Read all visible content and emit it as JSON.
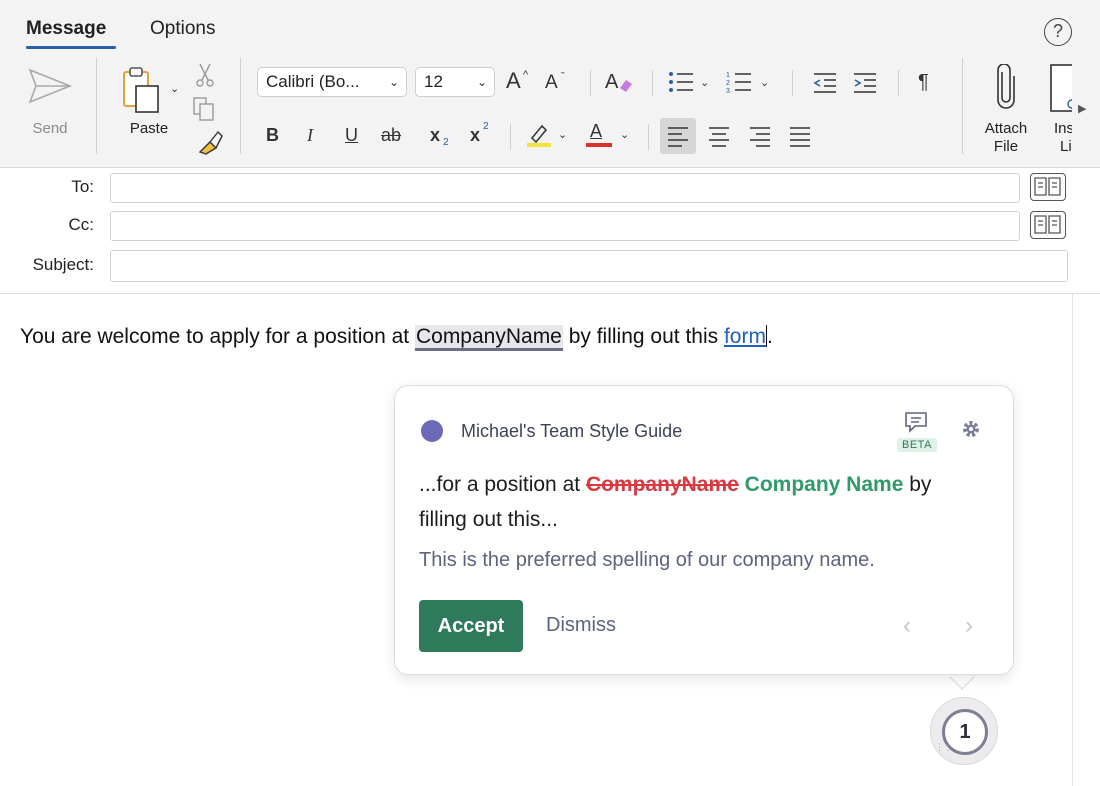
{
  "tabs": [
    {
      "label": "Message",
      "active": true
    },
    {
      "label": "Options",
      "active": false
    }
  ],
  "help_symbol": "?",
  "toolbar": {
    "send_label": "Send",
    "paste_label": "Paste",
    "font_name": "Calibri (Bo...",
    "font_size": "12",
    "grow_font": "A",
    "shrink_font": "A",
    "bold": "B",
    "italic": "I",
    "underline": "U",
    "strike": "ab",
    "subscript": "x",
    "subscript_mark": "2",
    "superscript": "x",
    "superscript_mark": "2",
    "font_color": "A",
    "paragraph_mark": "¶",
    "attach_file_label_1": "Attach",
    "attach_file_label_2": "File",
    "insert_link_label_1": "Ins",
    "insert_link_label_2": "Li",
    "highlight_color": "#f2e33a",
    "font_color_bar": "#d93030"
  },
  "fields": {
    "to_label": "To:",
    "to_value": "",
    "cc_label": "Cc:",
    "cc_value": "",
    "subject_label": "Subject:",
    "subject_value": ""
  },
  "body": {
    "text_before": "You are welcome to apply for a position at ",
    "highlighted_word": "CompanyName",
    "text_middle": " by filling out this ",
    "link_text": "form",
    "text_after": "."
  },
  "suggestion_card": {
    "guide_name": "Michael's Team Style Guide",
    "beta_label": "BETA",
    "context_prefix": "...for a position at ",
    "removed_text": "CompanyName",
    "inserted_text": "Company Name",
    "context_suffix": " by",
    "context_line2": "filling out this...",
    "explanation": "This is the preferred spelling of our company name.",
    "accept_label": "Accept",
    "dismiss_label": "Dismiss",
    "prev_arrow": "‹",
    "next_arrow": "›",
    "dot_color": "#6c6ab8",
    "accept_color": "#2f7a5b"
  },
  "issue_badge": {
    "count": "1"
  }
}
